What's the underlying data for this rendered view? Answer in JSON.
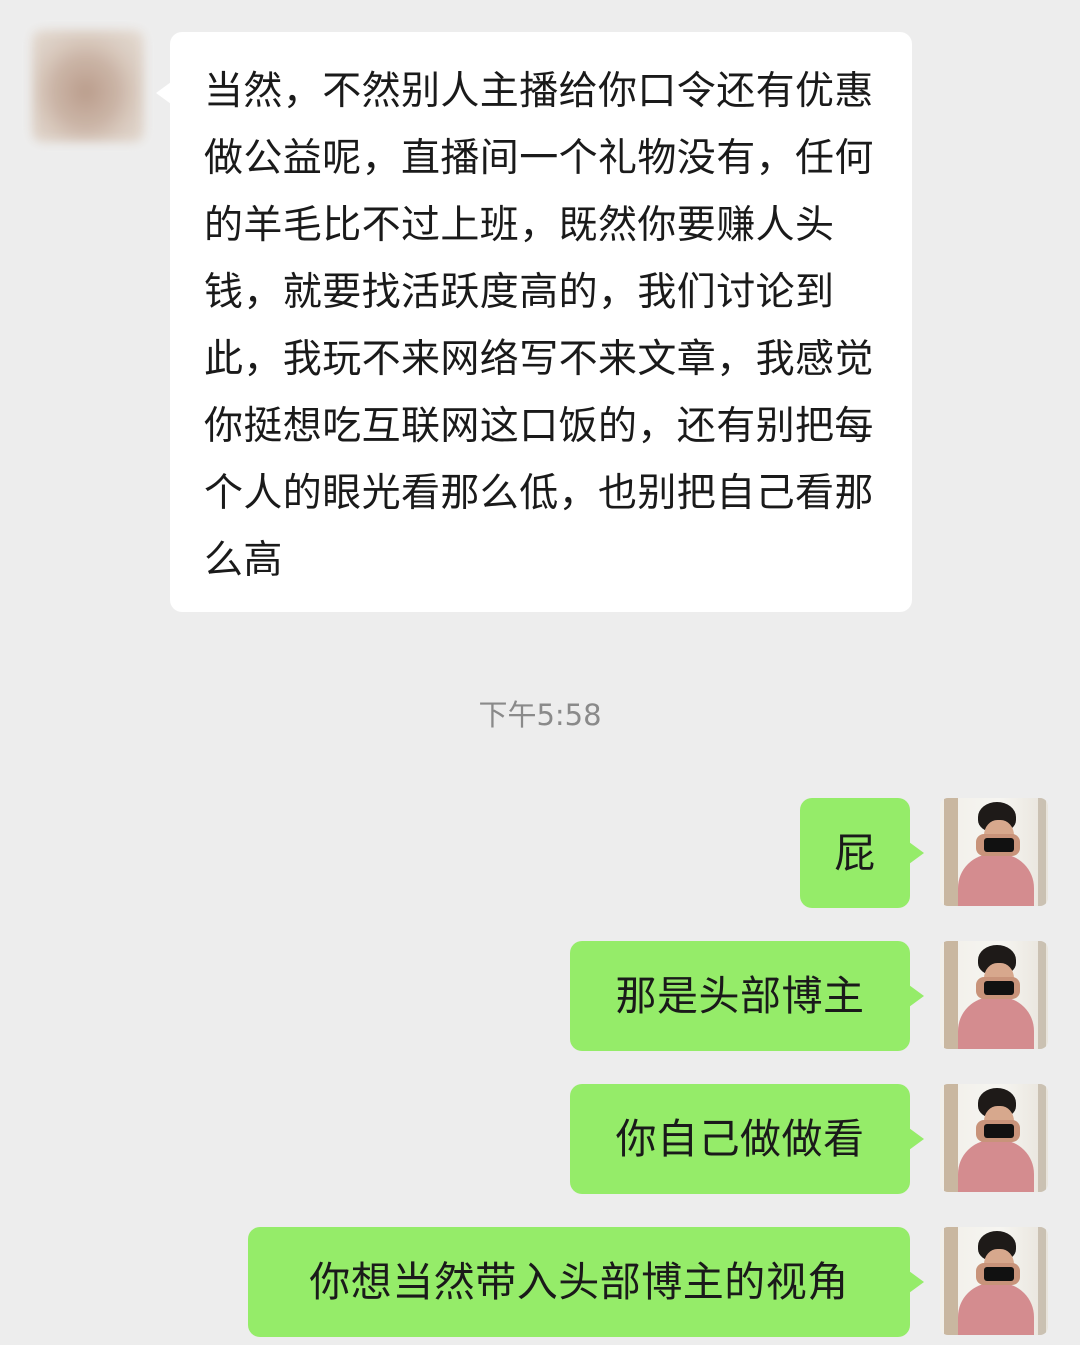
{
  "conversation": {
    "incoming_message": {
      "text": "当然，不然别人主播给你口令还有优惠做公益呢，直播间一个礼物没有，任何的羊毛比不过上班，既然你要赚人头钱，就要找活跃度高的，我们讨论到此，我玩不来网络写不来文章，我感觉你挺想吃互联网这口饭的，还有别把每个人的眼光看那么低，也别把自己看那么高"
    },
    "timestamp": "下午5:58",
    "outgoing_messages": [
      {
        "text": "屁"
      },
      {
        "text": "那是头部博主"
      },
      {
        "text": "你自己做做看"
      },
      {
        "text": "你想当然带入头部博主的视角"
      }
    ]
  },
  "colors": {
    "background": "#ededed",
    "incoming_bubble": "#ffffff",
    "outgoing_bubble": "#95ec69",
    "text": "#1a1a1a",
    "timestamp_text": "#8a8a8a"
  }
}
